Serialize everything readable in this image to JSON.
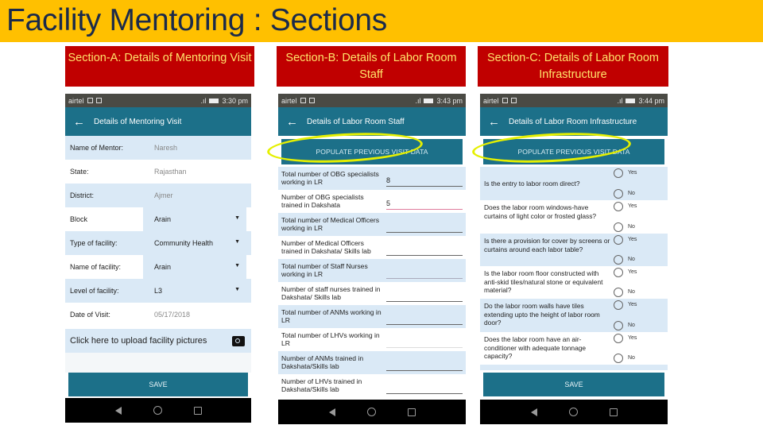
{
  "slide": {
    "title": "Facility Mentoring : Sections",
    "colors": {
      "title_bg": "#ffc000",
      "section_bg": "#c00000",
      "section_text": "#ffe36a",
      "appbar": "#1c7089",
      "row_alt": "#dae9f6",
      "highlight": "#e5f000"
    }
  },
  "sections": [
    {
      "label": "Section-A: Details of Mentoring Visit"
    },
    {
      "label": "Section-B: Details of Labor Room Staff"
    },
    {
      "label": "Section-C: Details of Labor Room Infrastructure"
    }
  ],
  "phone_a": {
    "status": {
      "carrier": "airtel",
      "time": "3:30 pm"
    },
    "appbar": {
      "back_icon": "arrow-left-icon",
      "title": "Details of Mentoring Visit"
    },
    "fields": [
      {
        "label": "Name of Mentor:",
        "value": "Naresh",
        "dropdown": false
      },
      {
        "label": "State:",
        "value": "Rajasthan",
        "dropdown": false
      },
      {
        "label": "District:",
        "value": "Ajmer",
        "dropdown": false
      },
      {
        "label": "Block",
        "value": "Arain",
        "dropdown": true
      },
      {
        "label": "Type of facility:",
        "value": "Community Health",
        "dropdown": true
      },
      {
        "label": "Name of facility:",
        "value": "Arain",
        "dropdown": true
      },
      {
        "label": "Level of facility:",
        "value": "L3",
        "dropdown": true
      },
      {
        "label": "Date of Visit:",
        "value": "05/17/2018",
        "dropdown": false
      }
    ],
    "upload_label": "Click here to upload facility pictures",
    "save_label": "SAVE"
  },
  "phone_b": {
    "status": {
      "carrier": "airtel",
      "time": "3:43 pm"
    },
    "appbar": {
      "back_icon": "arrow-left-icon",
      "title": "Details of Labor Room Staff"
    },
    "populate_label": "POPULATE PREVIOUS VISIT DATA",
    "fields": [
      {
        "label": "Total number of OBG specialists working in LR",
        "value": "8"
      },
      {
        "label": "Number of OBG specialists trained in Dakshata",
        "value": "5"
      },
      {
        "label": "Total number of Medical Officers working in LR",
        "value": ""
      },
      {
        "label": "Number of Medical Officers trained in Dakshata/ Skills lab",
        "value": ""
      },
      {
        "label": "Total number of Staff Nurses working in LR",
        "value": ""
      },
      {
        "label": "Number of staff nurses trained in Dakshata/ Skills lab",
        "value": ""
      },
      {
        "label": "Total number of ANMs working in LR",
        "value": ""
      },
      {
        "label": "Total number of LHVs working in LR",
        "value": ""
      },
      {
        "label": "Number of ANMs trained in Dakshata/Skills lab",
        "value": ""
      },
      {
        "label": "Number of LHVs trained in Dakshata/Skills lab",
        "value": ""
      }
    ]
  },
  "phone_c": {
    "status": {
      "carrier": "airtel",
      "time": "3:44 pm"
    },
    "appbar": {
      "back_icon": "arrow-left-icon",
      "title": "Details of Labor Room Infrastructure"
    },
    "populate_label": "POPULATE PREVIOUS VISIT DATA",
    "yes_label": "Yes",
    "no_label": "No",
    "questions": [
      {
        "text": "Is the entry to labor room direct?"
      },
      {
        "text": "Does the labor room windows-have curtains of light color or frosted glass?"
      },
      {
        "text": "Is there a provision for cover by screens or curtains around each labor table?"
      },
      {
        "text": "Is the labor room floor constructed with anti-skid tiles/natural stone or equivalent material?"
      },
      {
        "text": "Do the labor room walls have tiles extending upto the height of labor room door?"
      },
      {
        "text": "Does the labor room have an air-conditioner with adequate tonnage capacity?"
      }
    ],
    "save_label": "SAVE"
  }
}
